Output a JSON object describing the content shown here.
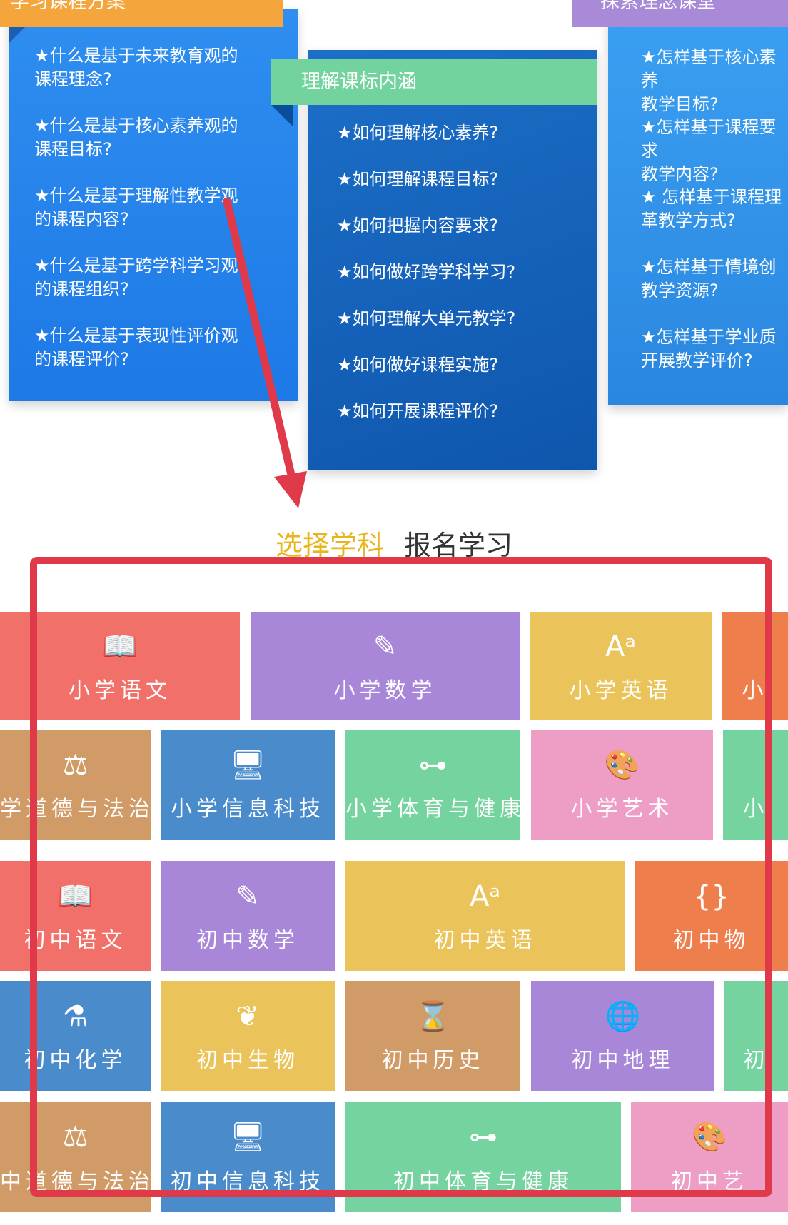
{
  "cards": {
    "left": {
      "tab_label": "学习课程方案",
      "questions": [
        "★什么是基于未来教育观的\n课程理念?",
        "★什么是基于核心素养观的\n课程目标?",
        "★什么是基于理解性教学观\n的课程内容?",
        "★什么是基于跨学科学习观\n的课程组织?",
        "★什么是基于表现性评价观\n的课程评价?"
      ]
    },
    "middle": {
      "tab_label": "理解课标内涵",
      "questions": [
        "★如何理解核心素养?",
        "★如何理解课程目标?",
        "★如何把握内容要求?",
        "★如何做好跨学科学习?",
        "★如何理解大单元教学?",
        "★如何做好课程实施?",
        "★如何开展课程评价?"
      ]
    },
    "right": {
      "tab_label": "探索理念课堂",
      "questions": [
        "★怎样基于核心素养\n教学目标?",
        "★怎样基于课程要求\n教学内容?",
        "★ 怎样基于课程理\n革教学方式?",
        "★怎样基于情境创\n教学资源?",
        "★怎样基于学业质\n开展教学评价?"
      ]
    }
  },
  "heading": {
    "highlight": "选择学科",
    "rest": "报名学习"
  },
  "colors": {
    "red": "#f2706a",
    "purple": "#a987d8",
    "yellow": "#eac35a",
    "orange": "#ee7f4d",
    "tan": "#d19b68",
    "blue": "#4a8bcb",
    "green": "#74d39f",
    "pink": "#ee9dc4",
    "frame": "#e0394a",
    "arrow": "#e0394a"
  },
  "tiles": [
    {
      "label": "小学语文",
      "icon": "book-pen-icon",
      "glyph": "📖"
    },
    {
      "label": "小学数学",
      "icon": "pencil-ruler-icon",
      "glyph": "✎"
    },
    {
      "label": "小学英语",
      "icon": "text-size-icon",
      "glyph": "Aᵃ"
    },
    {
      "label": "小",
      "icon": "",
      "glyph": ""
    },
    {
      "label": "学道德与法治",
      "icon": "gavel-icon",
      "glyph": "⚖"
    },
    {
      "label": "小学信息科技",
      "icon": "monitor-icon",
      "glyph": "🖥"
    },
    {
      "label": "小学体育与健康",
      "icon": "dumbbell-icon",
      "glyph": "⊶"
    },
    {
      "label": "小学艺术",
      "icon": "palette-icon",
      "glyph": "🎨"
    },
    {
      "label": "小",
      "icon": "",
      "glyph": ""
    },
    {
      "label": "初中语文",
      "icon": "book-pen-icon",
      "glyph": "📖"
    },
    {
      "label": "初中数学",
      "icon": "pencil-ruler-icon",
      "glyph": "✎"
    },
    {
      "label": "初中英语",
      "icon": "text-size-icon",
      "glyph": "Aᵃ"
    },
    {
      "label": "初中物",
      "icon": "braces-icon",
      "glyph": "{}"
    },
    {
      "label": "初中化学",
      "icon": "flask-icon",
      "glyph": "⚗"
    },
    {
      "label": "初中生物",
      "icon": "leaf-icon",
      "glyph": "❦"
    },
    {
      "label": "初中历史",
      "icon": "hourglass-icon",
      "glyph": "⌛"
    },
    {
      "label": "初中地理",
      "icon": "globe-icon",
      "glyph": "🌐"
    },
    {
      "label": "初",
      "icon": "",
      "glyph": ""
    },
    {
      "label": "中道德与法治",
      "icon": "gavel-icon",
      "glyph": "⚖"
    },
    {
      "label": "初中信息科技",
      "icon": "monitor-icon",
      "glyph": "🖥"
    },
    {
      "label": "初中体育与健康",
      "icon": "dumbbell-icon",
      "glyph": "⊶"
    },
    {
      "label": "初中艺",
      "icon": "palette-icon",
      "glyph": "🎨"
    }
  ]
}
